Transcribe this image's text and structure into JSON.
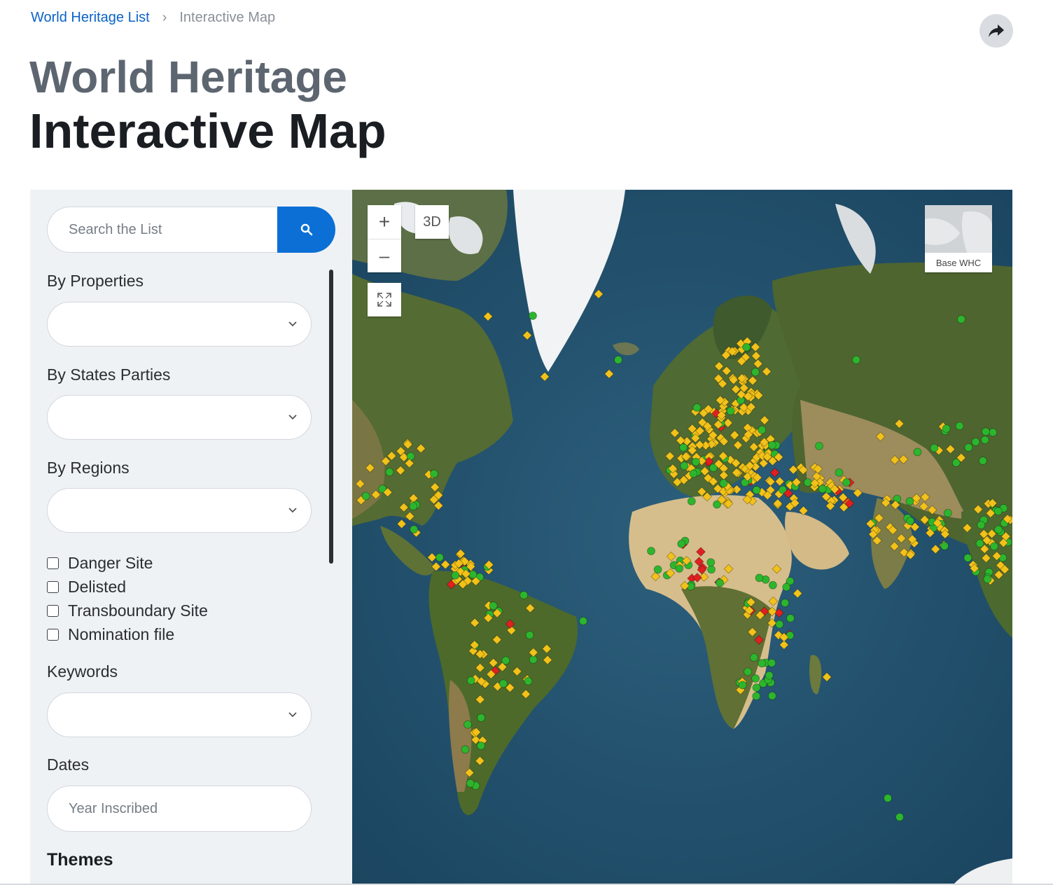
{
  "breadcrumb": {
    "parent": "World Heritage List",
    "separator": "›",
    "current": "Interactive Map"
  },
  "share": {
    "icon": "share-arrow-icon"
  },
  "title": {
    "line1": "World Heritage",
    "line2": "Interactive Map"
  },
  "sidebar": {
    "search": {
      "placeholder": "Search the List",
      "icon": "search-icon"
    },
    "filters": [
      {
        "label": "By Properties",
        "value": ""
      },
      {
        "label": "By States Parties",
        "value": ""
      },
      {
        "label": "By Regions",
        "value": ""
      }
    ],
    "checkboxes": [
      {
        "label": "Danger Site",
        "checked": false
      },
      {
        "label": "Delisted",
        "checked": false
      },
      {
        "label": "Transboundary Site",
        "checked": false
      },
      {
        "label": "Nomination file",
        "checked": false
      }
    ],
    "keywords": {
      "label": "Keywords",
      "value": ""
    },
    "dates": {
      "label": "Dates",
      "placeholder": "Year Inscribed"
    },
    "themes": {
      "label": "Themes"
    }
  },
  "map": {
    "controls": {
      "zoom_in": "+",
      "zoom_out": "–",
      "mode_3d": "3D",
      "fullscreen_icon": "fullscreen-icon"
    },
    "basemap_label": "Base WHC",
    "marker_colors": {
      "cultural": "#f2c21a",
      "natural": "#2db52d",
      "danger": "#e02020"
    }
  }
}
